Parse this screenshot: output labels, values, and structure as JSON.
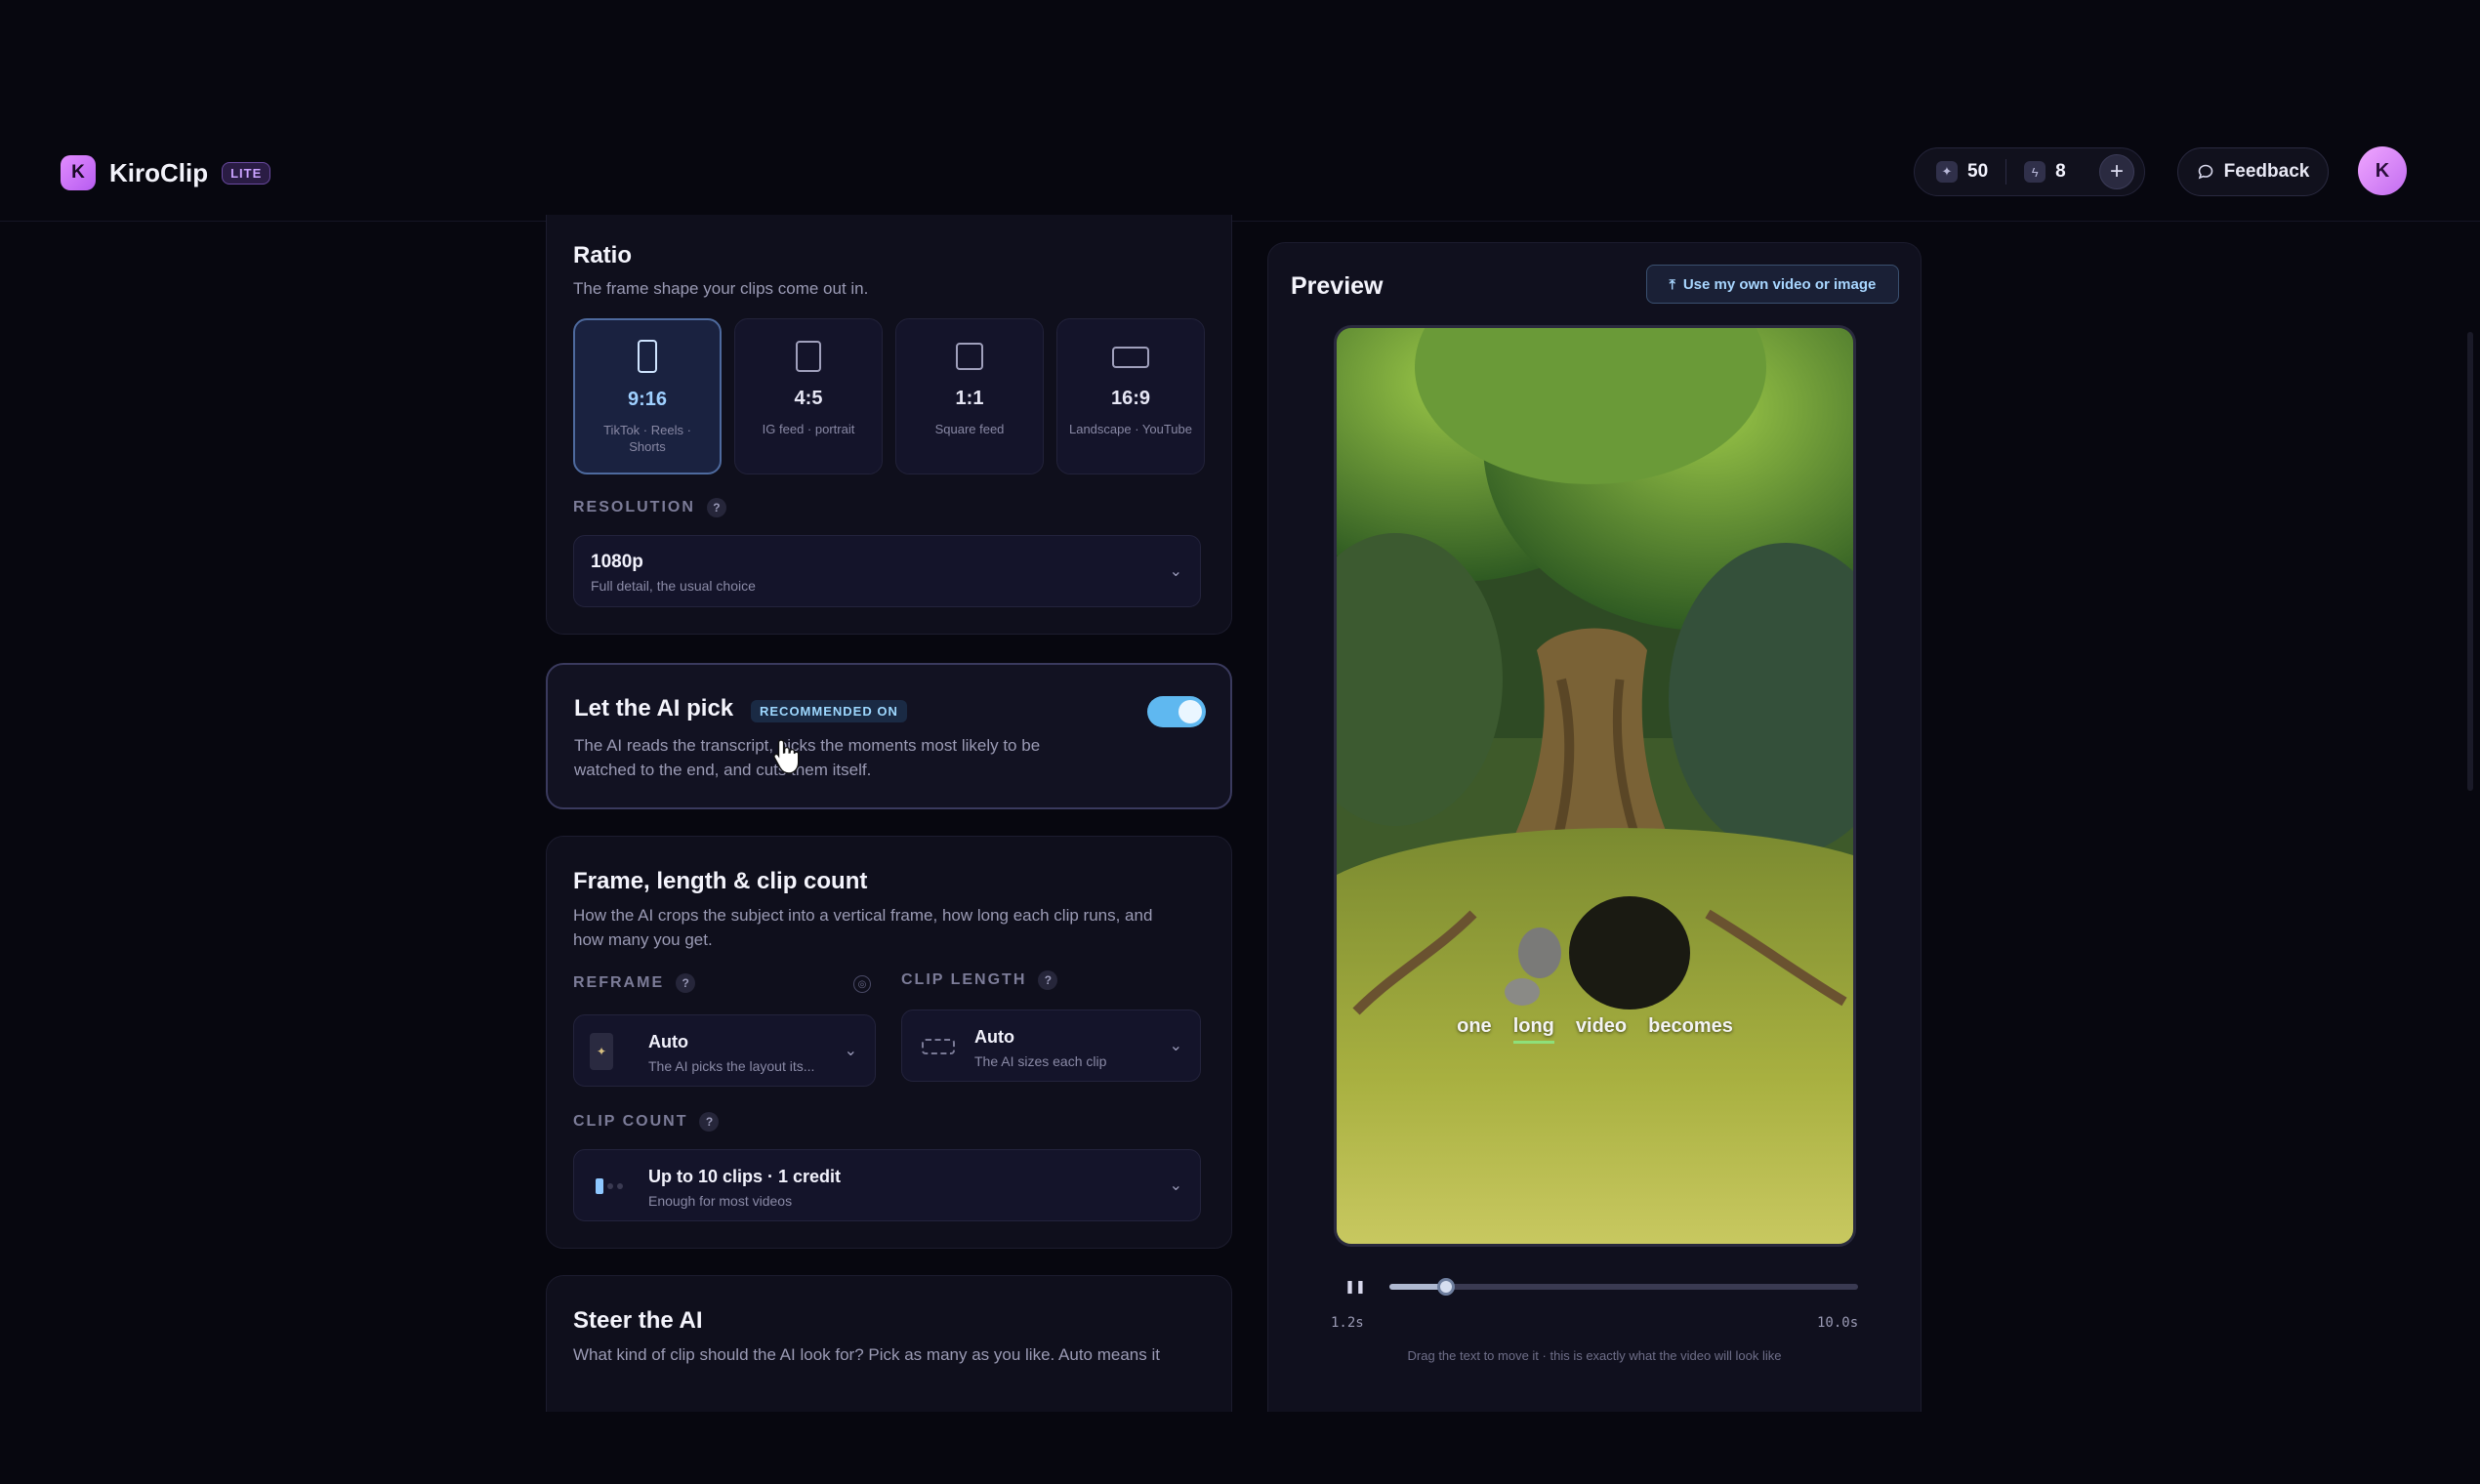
{
  "app": {
    "name": "KiroClip",
    "logo_letter": "K",
    "badge": "LITE"
  },
  "header": {
    "credits": [
      {
        "icon": "sparkle-icon",
        "value": "50"
      },
      {
        "icon": "bolt-icon",
        "value": "8"
      }
    ],
    "add_label": "+",
    "feedback_label": "Feedback",
    "avatar_letter": "K"
  },
  "ratio": {
    "title": "Ratio",
    "subtitle": "The frame shape your clips come out in.",
    "options": [
      {
        "value": "9:16",
        "desc": "TikTok · Reels · Shorts",
        "selected": true
      },
      {
        "value": "4:5",
        "desc": "IG feed · portrait",
        "selected": false
      },
      {
        "value": "1:1",
        "desc": "Square feed",
        "selected": false
      },
      {
        "value": "16:9",
        "desc": "Landscape · YouTube",
        "selected": false
      }
    ],
    "resolution_label": "RESOLUTION",
    "resolution": {
      "value": "1080p",
      "desc": "Full detail, the usual choice"
    }
  },
  "ai_pick": {
    "title": "Let the AI pick",
    "badge": "RECOMMENDED ON",
    "desc_line1": "The AI reads the transcript, picks the moments most likely to be",
    "desc_line2": "watched to the end, and cuts them itself.",
    "enabled": true
  },
  "frame": {
    "title": "Frame, length & clip count",
    "subtitle_line1": "How the AI crops the subject into a vertical frame, how long each clip runs, and",
    "subtitle_line2": "how many you get.",
    "reframe_label": "REFRAME",
    "reframe": {
      "value": "Auto",
      "desc": "The AI picks the layout its..."
    },
    "clip_length_label": "CLIP LENGTH",
    "clip_length": {
      "value": "Auto",
      "desc": "The AI sizes each clip"
    },
    "clip_count_label": "CLIP COUNT",
    "clip_count": {
      "value": "Up to 10 clips · 1 credit",
      "desc": "Enough for most videos"
    }
  },
  "steer": {
    "title": "Steer the AI",
    "subtitle": "What kind of clip should the AI look for? Pick as many as you like. Auto means it"
  },
  "preview": {
    "title": "Preview",
    "upload_label": "Use my own video or image",
    "caption_words": [
      "one",
      "long",
      "video",
      "becomes"
    ],
    "highlighted_word": "long",
    "time_current": "1.2s",
    "time_total": "10.0s",
    "progress": 0.12,
    "hint": "Drag the text to move it · this is exactly what the video will look like"
  },
  "colors": {
    "accent": "#5fb8f0",
    "brand": "#c26df0",
    "background": "#07070f"
  }
}
